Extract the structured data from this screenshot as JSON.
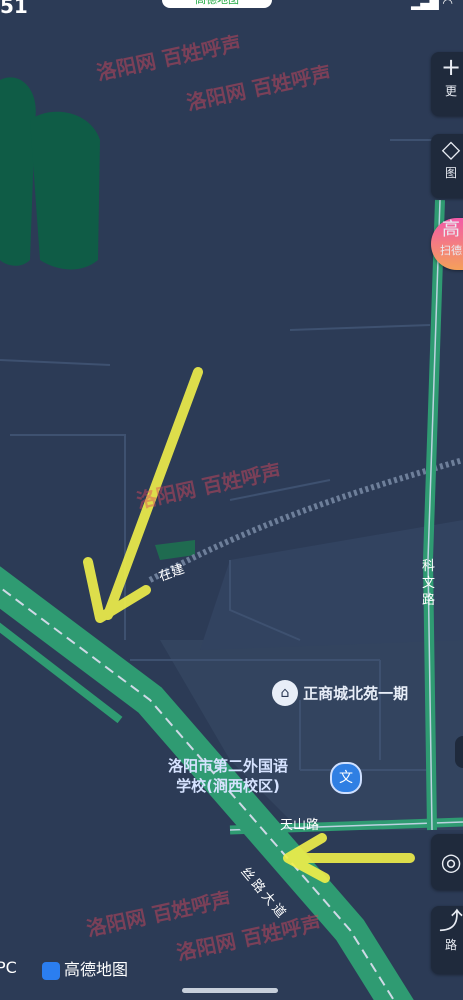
{
  "status": {
    "time": "51",
    "pill_label": "高德地图"
  },
  "controls": {
    "more_label": "更",
    "layers_label": "图",
    "promo_title": "高",
    "promo_sub": "扫德",
    "locate_label": "",
    "route_label": "路"
  },
  "roads": {
    "zaijian": "在建",
    "kewen": "科文路",
    "tianshan": "天山路",
    "silu": "丝路大道"
  },
  "pois": {
    "zhengshang": "正商城北苑一期",
    "school_line1": "洛阳市第二外国语",
    "school_line2": "学校(涧西校区)",
    "school_badge": "文"
  },
  "watermark": {
    "site": "洛阳网",
    "brand": "百姓呼声"
  },
  "bottom": {
    "left_text": "PC",
    "logo_text": "高德地图"
  },
  "colors": {
    "map_bg": "#2b3a55",
    "road_green": "#3aa87a",
    "park": "#0f5c46",
    "arrow": "#f1f04a"
  }
}
